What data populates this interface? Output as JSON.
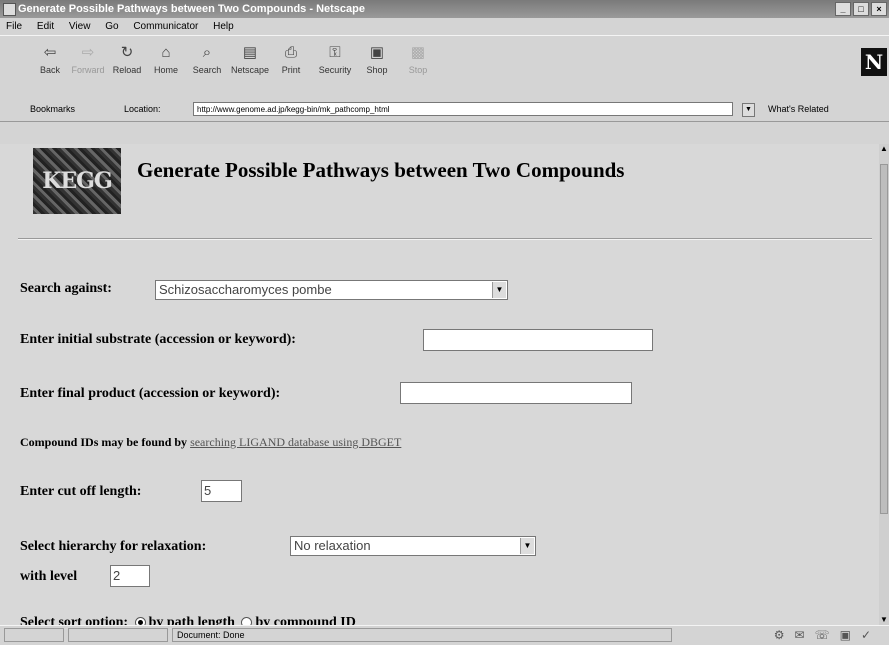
{
  "window": {
    "title": "Generate Possible Pathways between Two Compounds - Netscape",
    "controls": [
      "_",
      "□",
      "×"
    ]
  },
  "menu": [
    "File",
    "Edit",
    "View",
    "Go",
    "Communicator",
    "Help"
  ],
  "toolbar": [
    {
      "label": "Back",
      "icon": "back-arrow-icon",
      "glyph": "⇦",
      "enabled": true
    },
    {
      "label": "Forward",
      "icon": "forward-arrow-icon",
      "glyph": "⇨",
      "enabled": false
    },
    {
      "label": "Reload",
      "icon": "reload-icon",
      "glyph": "↻",
      "enabled": true
    },
    {
      "label": "Home",
      "icon": "home-icon",
      "glyph": "⌂",
      "enabled": true
    },
    {
      "label": "Search",
      "icon": "search-icon",
      "glyph": "⌕",
      "enabled": true
    },
    {
      "label": "Netscape",
      "icon": "netscape-icon",
      "glyph": "▤",
      "enabled": true
    },
    {
      "label": "Print",
      "icon": "print-icon",
      "glyph": "⎙",
      "enabled": true
    },
    {
      "label": "Security",
      "icon": "security-lock-icon",
      "glyph": "⚿",
      "enabled": true
    },
    {
      "label": "Shop",
      "icon": "shop-bag-icon",
      "glyph": "▣",
      "enabled": true
    },
    {
      "label": "Stop",
      "icon": "stop-icon",
      "glyph": "▩",
      "enabled": false
    }
  ],
  "location": {
    "bookmarks_label": "Bookmarks",
    "location_label": "Location:",
    "url": "http://www.genome.ad.jp/kegg-bin/mk_pathcomp_html",
    "related_label": "What's Related"
  },
  "page": {
    "logo_text": "KEGG",
    "title": "Generate Possible Pathways between Two Compounds",
    "search_against_label": "Search against:",
    "search_against_value": "Schizosaccharomyces pombe",
    "initial_substrate_label": "Enter initial substrate (accession or keyword):",
    "initial_substrate_value": "",
    "final_product_label": "Enter final product (accession or keyword):",
    "final_product_value": "",
    "compound_ids_text": "Compound IDs may be found by",
    "compound_ids_link": "searching LIGAND database using DBGET",
    "cutoff_label": "Enter cut off length:",
    "cutoff_value": "5",
    "hierarchy_label": "Select hierarchy for relaxation:",
    "hierarchy_value": "No relaxation",
    "level_label": "with level",
    "level_value": "2",
    "sort_label": "Select sort option:",
    "sort_options": [
      "by path length",
      "by compound ID"
    ],
    "sort_selected": "by path length"
  },
  "status": {
    "text": "Document: Done"
  }
}
